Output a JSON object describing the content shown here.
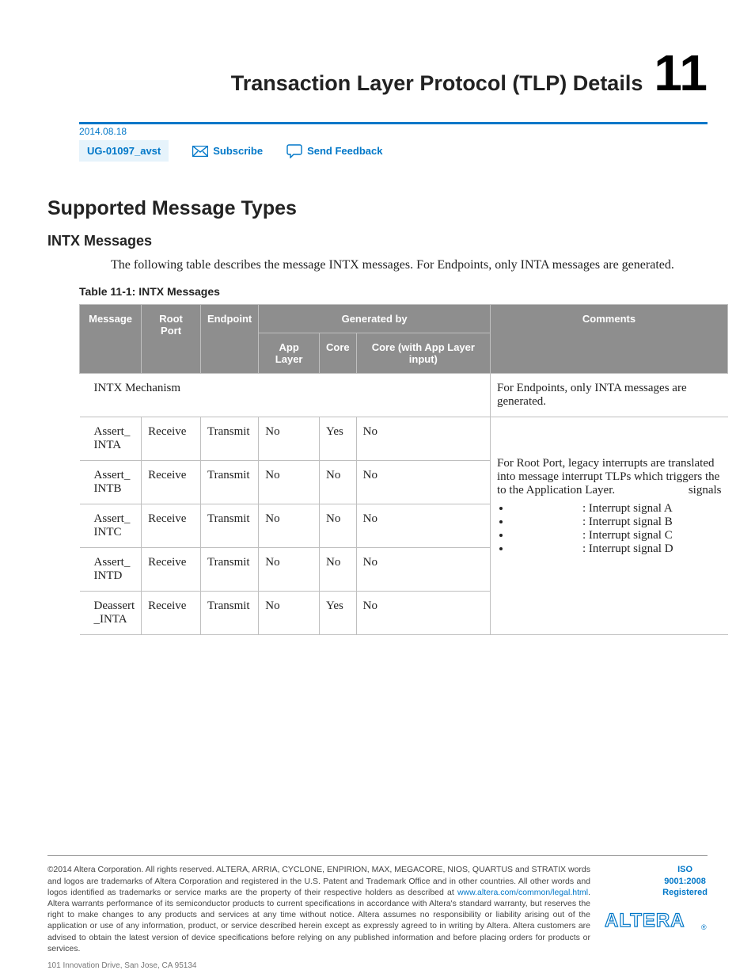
{
  "chapter": {
    "title": "Transaction Layer Protocol (TLP) Details",
    "number": "11"
  },
  "meta": {
    "date": "2014.08.18",
    "doc_id": "UG-01097_avst",
    "subscribe": "Subscribe",
    "feedback": "Send Feedback"
  },
  "section": {
    "h1": "Supported Message Types",
    "h2": "INTX Messages",
    "intro": "The following table describes the message INTX messages. For Endpoints, only INTA messages are generated."
  },
  "table": {
    "caption": "Table 11-1: INTX Messages",
    "headers": {
      "message": "Message",
      "root_port": "Root Port",
      "endpoint": "Endpoint",
      "generated_by": "Generated by",
      "app_layer": "App Layer",
      "core": "Core",
      "core_input": "Core (with App Layer input)",
      "comments": "Comments"
    },
    "mechanism_row": {
      "label": "INTX Mechanism",
      "comment": "For Endpoints, only INTA messages are generated."
    },
    "rows": [
      {
        "msg": "Assert_\nINTA",
        "root": "Receive",
        "ep": "Transmit",
        "app": "No",
        "core": "Yes",
        "corein": "No"
      },
      {
        "msg": "Assert_\nINTB",
        "root": "Receive",
        "ep": "Transmit",
        "app": "No",
        "core": "No",
        "corein": "No"
      },
      {
        "msg": "Assert_\nINTC",
        "root": "Receive",
        "ep": "Transmit",
        "app": "No",
        "core": "No",
        "corein": "No"
      },
      {
        "msg": "Assert_\nINTD",
        "root": "Receive",
        "ep": "Transmit",
        "app": "No",
        "core": "No",
        "corein": "No"
      },
      {
        "msg": "Deassert\n_INTA",
        "root": "Receive",
        "ep": "Transmit",
        "app": "No",
        "core": "Yes",
        "corein": "No"
      }
    ],
    "comments_block": {
      "para1": "For Root Port, legacy interrupts are translated into message interrupt TLPs which triggers the",
      "para1_tail": "signals",
      "para2": "to the Application Layer.",
      "bullets": [
        ": Interrupt signal A",
        ": Interrupt signal B",
        ": Interrupt signal C",
        ": Interrupt signal D"
      ]
    }
  },
  "footer": {
    "copyright_year": "2014",
    "text1": " Altera Corporation. All rights reserved. ALTERA, ARRIA, CYCLONE, ENPIRION, MAX, MEGACORE, NIOS, QUARTUS and STRATIX words and logos are trademarks of Altera Corporation and registered in the U.S. Patent and Trademark Office and in other countries. All other words and logos identified as trademarks or service marks are the property of their respective holders as described at ",
    "legal_link": "www.altera.com/common/legal.html",
    "text2": ". Altera warrants performance of its semiconductor products to current specifications in accordance with Altera's standard warranty, but reserves the right to make changes to any products and services at any time without notice. Altera assumes no responsibility or liability arising out of the application or use of any information, product, or service described herein except as expressly agreed to in writing by Altera. Altera customers are advised to obtain the latest version of device specifications before relying on any published information and before placing orders for products or services.",
    "iso": "ISO\n9001:2008\nRegistered",
    "address": "101 Innovation Drive, San Jose, CA 95134",
    "logo_text": "ALTERA"
  }
}
